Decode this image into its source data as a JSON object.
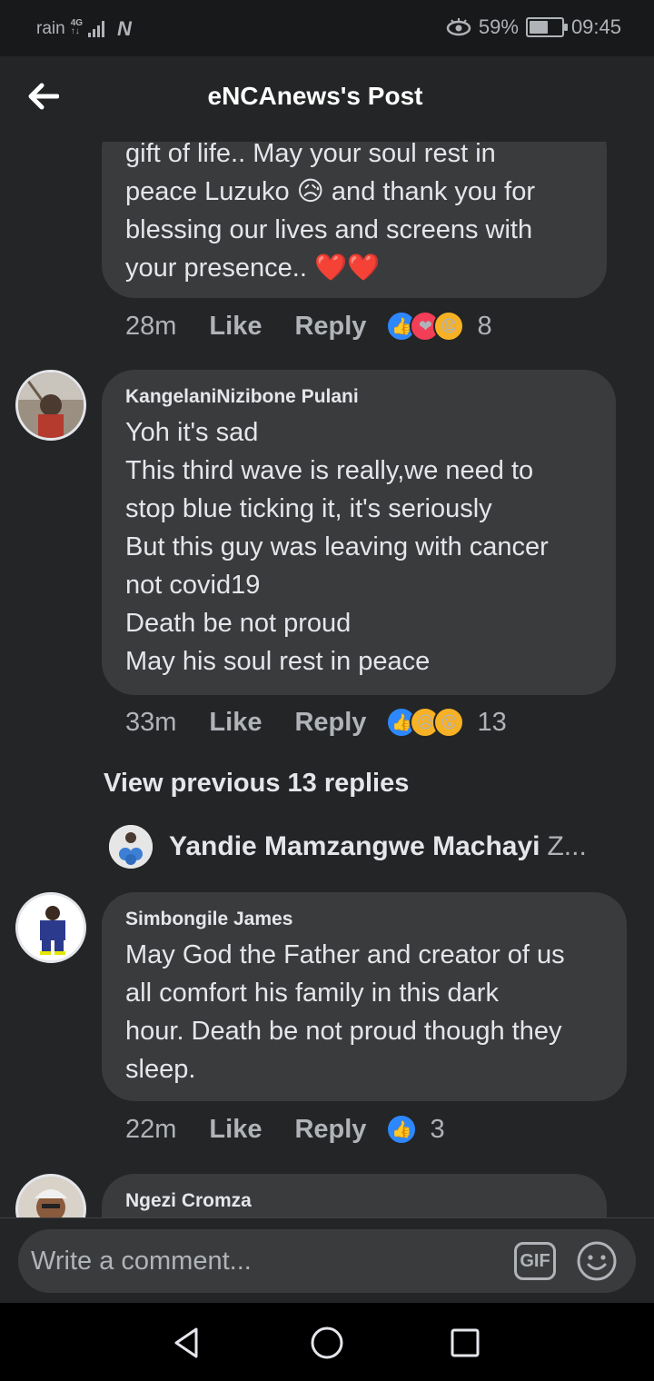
{
  "status_bar": {
    "carrier": "rain",
    "network_type_top": "4G",
    "network_type_bottom": "↑↓",
    "nfc_label": "N",
    "battery_percent": "59%",
    "battery_level": 0.59,
    "time": "09:45"
  },
  "header": {
    "title": "eNCAnews's Post"
  },
  "comments": [
    {
      "text": "gift of life.. May your soul rest in\npeace Luzuko 😥 and thank you for\nblessing our lives and screens with\nyour presence.. ❤️❤️",
      "time": "28m",
      "like_label": "Like",
      "reply_label": "Reply",
      "reaction_icons": [
        "👍",
        "❤",
        "😧"
      ],
      "reaction_count": "8"
    },
    {
      "author": "KangelaniNizibone Pulani",
      "text": "Yoh it's sad\nThis third wave is really,we need to\nstop blue ticking it, it's seriously\nBut this guy was leaving with cancer\nnot covid19\nDeath be not proud\nMay his soul rest in peace",
      "time": "33m",
      "like_label": "Like",
      "reply_label": "Reply",
      "reaction_icons": [
        "👍",
        "😥",
        "😮"
      ],
      "reaction_count": "13"
    },
    {
      "author": "Simbongile James",
      "text": "May God the Father and creator of us\nall comfort his family in this dark\nhour. Death be not proud though they\nsleep.",
      "time": "22m",
      "like_label": "Like",
      "reply_label": "Reply",
      "reaction_icons": [
        "👍"
      ],
      "reaction_count": "3"
    },
    {
      "author": "Ngezi Cromza"
    }
  ],
  "replies_section": {
    "view_previous_label": "View previous 13 replies",
    "reply_author": "Yandie Mamzangwe Machayi",
    "reply_snippet": "Z..."
  },
  "composer": {
    "placeholder": "Write a comment...",
    "gif_label": "GIF"
  },
  "colors": {
    "background": "#242526",
    "bubble": "#3a3b3c",
    "text_primary": "#e4e6eb",
    "text_secondary": "#b0b3b8",
    "like_blue": "#2d88ff",
    "love_red": "#f33e58",
    "emoji_yellow": "#f7b125"
  }
}
